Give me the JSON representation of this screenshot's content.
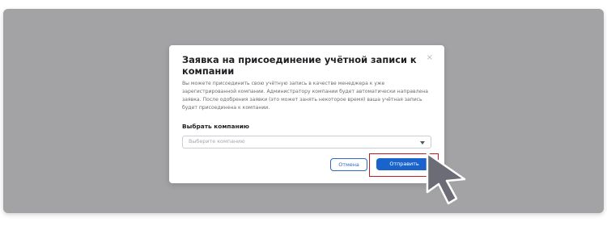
{
  "modal": {
    "title": "Заявка на присоединение учётной записи к компании",
    "close_icon": "×",
    "description": "Вы можете присоединить свою учётную запись в качестве менеджера к уже зарегистрированной компании. Администратору компании будет автоматически направлена заявка. После одобрения заявки (это может занять некоторое время) ваша учётная запись будет присоединена к компании.",
    "select_label": "Выбрать компанию",
    "select_placeholder": "Выберите компанию",
    "cancel_label": "Отмена",
    "submit_label": "Отправить"
  },
  "colors": {
    "overlay": "#a3a3a6",
    "primary": "#1a63cd",
    "highlight": "#c21b24"
  },
  "icons": {
    "close": "close-icon",
    "caret": "chevron-down-icon",
    "pointer": "mouse-pointer-icon"
  }
}
